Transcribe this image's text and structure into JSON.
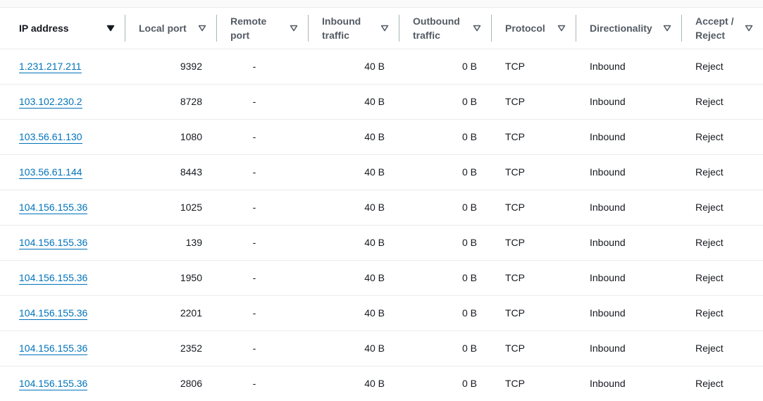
{
  "table": {
    "columns": [
      {
        "label": "IP address",
        "line1": "IP address",
        "line2": ""
      },
      {
        "label": "Local port",
        "line1": "Local port",
        "line2": ""
      },
      {
        "label": "Remote port",
        "line1": "Remote",
        "line2": "port"
      },
      {
        "label": "Inbound traffic",
        "line1": "Inbound",
        "line2": "traffic"
      },
      {
        "label": "Outbound traffic",
        "line1": "Outbound",
        "line2": "traffic"
      },
      {
        "label": "Protocol",
        "line1": "Protocol",
        "line2": ""
      },
      {
        "label": "Directionality",
        "line1": "Directionality",
        "line2": ""
      },
      {
        "label": "Accept / Reject",
        "line1": "Accept /",
        "line2": "Reject"
      }
    ],
    "sort_icon": "caret-down-filter-icon",
    "rows": [
      {
        "ip": "1.231.217.211",
        "local_port": "9392",
        "remote_port": "-",
        "inbound": "40 B",
        "outbound": "0 B",
        "protocol": "TCP",
        "direction": "Inbound",
        "action": "Reject"
      },
      {
        "ip": "103.102.230.2",
        "local_port": "8728",
        "remote_port": "-",
        "inbound": "40 B",
        "outbound": "0 B",
        "protocol": "TCP",
        "direction": "Inbound",
        "action": "Reject"
      },
      {
        "ip": "103.56.61.130",
        "local_port": "1080",
        "remote_port": "-",
        "inbound": "40 B",
        "outbound": "0 B",
        "protocol": "TCP",
        "direction": "Inbound",
        "action": "Reject"
      },
      {
        "ip": "103.56.61.144",
        "local_port": "8443",
        "remote_port": "-",
        "inbound": "40 B",
        "outbound": "0 B",
        "protocol": "TCP",
        "direction": "Inbound",
        "action": "Reject"
      },
      {
        "ip": "104.156.155.36",
        "local_port": "1025",
        "remote_port": "-",
        "inbound": "40 B",
        "outbound": "0 B",
        "protocol": "TCP",
        "direction": "Inbound",
        "action": "Reject"
      },
      {
        "ip": "104.156.155.36",
        "local_port": "139",
        "remote_port": "-",
        "inbound": "40 B",
        "outbound": "0 B",
        "protocol": "TCP",
        "direction": "Inbound",
        "action": "Reject"
      },
      {
        "ip": "104.156.155.36",
        "local_port": "1950",
        "remote_port": "-",
        "inbound": "40 B",
        "outbound": "0 B",
        "protocol": "TCP",
        "direction": "Inbound",
        "action": "Reject"
      },
      {
        "ip": "104.156.155.36",
        "local_port": "2201",
        "remote_port": "-",
        "inbound": "40 B",
        "outbound": "0 B",
        "protocol": "TCP",
        "direction": "Inbound",
        "action": "Reject"
      },
      {
        "ip": "104.156.155.36",
        "local_port": "2352",
        "remote_port": "-",
        "inbound": "40 B",
        "outbound": "0 B",
        "protocol": "TCP",
        "direction": "Inbound",
        "action": "Reject"
      },
      {
        "ip": "104.156.155.36",
        "local_port": "2806",
        "remote_port": "-",
        "inbound": "40 B",
        "outbound": "0 B",
        "protocol": "TCP",
        "direction": "Inbound",
        "action": "Reject"
      }
    ]
  },
  "colors": {
    "link": "#0073bb",
    "header_text": "#545b64",
    "body_text": "#16191f",
    "row_border": "#eaeded",
    "header_divider": "#aab7b8"
  }
}
